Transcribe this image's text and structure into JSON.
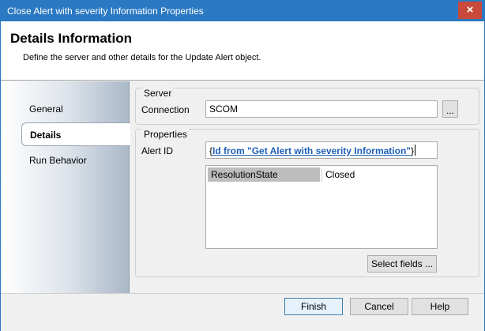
{
  "window": {
    "title": "Close Alert with severity Information Properties",
    "close_glyph": "×"
  },
  "header": {
    "title": "Details Information",
    "subtitle": "Define the server and other details for the Update Alert object."
  },
  "sidebar": {
    "items": [
      {
        "label": "General"
      },
      {
        "label": "Details"
      },
      {
        "label": "Run Behavior"
      }
    ],
    "active_index": 1
  },
  "server": {
    "group_title": "Server",
    "connection_label": "Connection",
    "connection_value": "SCOM",
    "browse_label": "..."
  },
  "properties": {
    "group_title": "Properties",
    "alert_id_label": "Alert ID",
    "alert_id_open": "{",
    "alert_id_link": "Id from \"Get Alert with severity Information\"",
    "alert_id_close": "}",
    "fields": [
      {
        "name": "ResolutionState",
        "value": "Closed"
      }
    ],
    "select_fields_label": "Select fields ..."
  },
  "footer": {
    "finish_label": "Finish",
    "cancel_label": "Cancel",
    "help_label": "Help"
  },
  "colors": {
    "titlebar": "#2b79c2",
    "close_button": "#c94a3b",
    "link": "#1f5fb8"
  }
}
